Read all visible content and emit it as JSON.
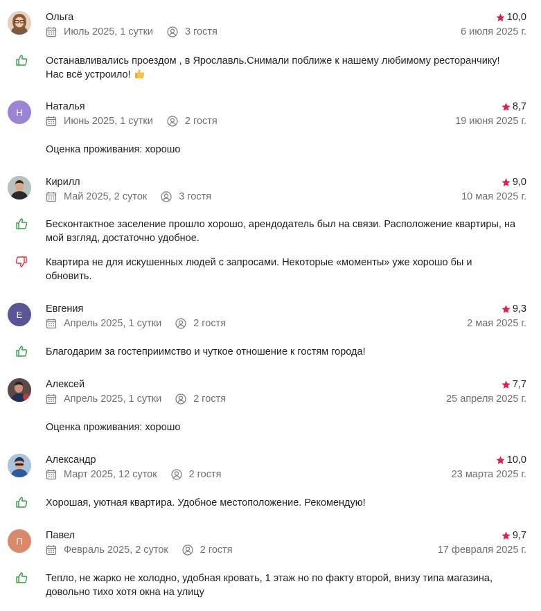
{
  "colors": {
    "star": "#e61e4d",
    "positive": "#2f9e44",
    "negative": "#d63939",
    "meta": "#6f6f6f",
    "text": "#222222"
  },
  "reviews": [
    {
      "name": "Ольга",
      "rating": "10,0",
      "stay": "Июль 2025, 1 сутки",
      "guests": "3 гостя",
      "date": "6 июля 2025 г.",
      "avatar": {
        "type": "photo",
        "initial": ""
      },
      "positive": "Останавливались проездом , в Ярославль.Снимали поближе к нашему любимому ресторанчику!",
      "positive2": "Нас всё устроило!",
      "negative": "",
      "negative2": ""
    },
    {
      "name": "Наталья",
      "rating": "8,7",
      "stay": "Июнь 2025, 1 сутки",
      "guests": "2 гостя",
      "date": "19 июня 2025 г.",
      "avatar": {
        "type": "letter",
        "initial": "Н",
        "color": "#9b83d6"
      },
      "plain": "Оценка проживания: хорошо"
    },
    {
      "name": "Кирилл",
      "rating": "9,0",
      "stay": "Май 2025, 2 суток",
      "guests": "3 гостя",
      "date": "10 мая 2025 г.",
      "avatar": {
        "type": "photo",
        "initial": ""
      },
      "positive": "Бесконтактное заселение прошло хорошо, арендодатель был на связи. Расположение квартиры, на",
      "positive2": "мой взгляд, достаточно удобное.",
      "negative": "Квартира не для искушенных людей с запросами. Некоторые «моменты» уже хорошо бы и",
      "negative2": "обновить."
    },
    {
      "name": "Евгения",
      "rating": "9,3",
      "stay": "Апрель 2025, 1 сутки",
      "guests": "2 гостя",
      "date": "2 мая 2025 г.",
      "avatar": {
        "type": "letter",
        "initial": "Е",
        "color": "#5a5596"
      },
      "positive": "Благодарим за гостеприимство и чуткое отношение к гостям города!"
    },
    {
      "name": "Алексей",
      "rating": "7,7",
      "stay": "Апрель 2025, 1 сутки",
      "guests": "2 гостя",
      "date": "25 апреля 2025 г.",
      "avatar": {
        "type": "photo",
        "initial": ""
      },
      "plain": "Оценка проживания: хорошо"
    },
    {
      "name": "Александр",
      "rating": "10,0",
      "stay": "Март 2025, 12 суток",
      "guests": "2 гостя",
      "date": "23 марта 2025 г.",
      "avatar": {
        "type": "photo",
        "initial": ""
      },
      "positive": "Хорошая, уютная квартира. Удобное местоположение. Рекомендую!"
    },
    {
      "name": "Павел",
      "rating": "9,7",
      "stay": "Февраль 2025, 2 суток",
      "guests": "2 гостя",
      "date": "17 февраля 2025 г.",
      "avatar": {
        "type": "letter",
        "initial": "П",
        "color": "#d98a6a"
      },
      "positive": "Тепло, не жарко не холодно, удобная кровать, 1 этаж но по факту второй, внизу типа магазина,",
      "positive2": "довольно тихо хотя окна на улицу"
    }
  ]
}
